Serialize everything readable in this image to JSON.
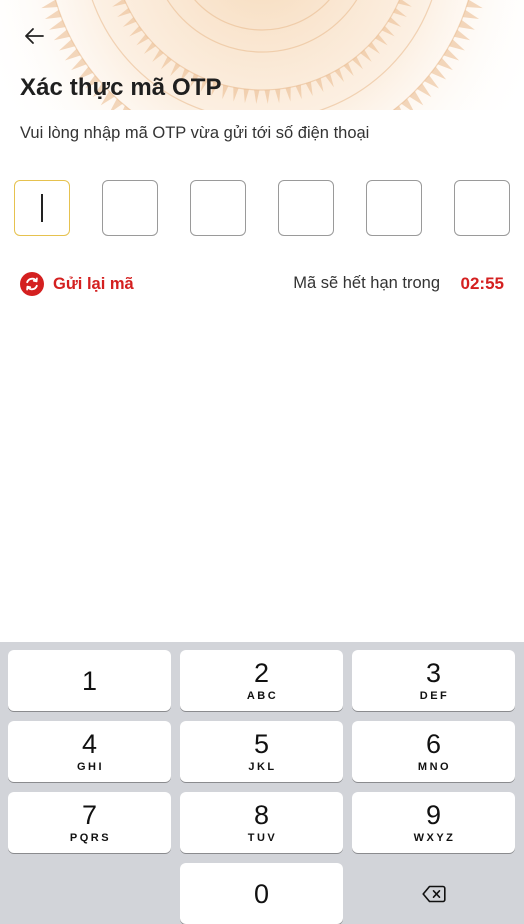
{
  "header": {
    "back_icon": "arrow-left-icon",
    "title": "Xác thực mã OTP",
    "subtitle": "Vui lòng nhập mã OTP vừa gửi tới số điện thoại"
  },
  "otp": {
    "length": 6,
    "values": [
      "",
      "",
      "",
      "",
      "",
      ""
    ],
    "active_index": 0,
    "active_color": "#e6c24f"
  },
  "resend": {
    "icon": "refresh-icon",
    "label": "Gửi lại mã"
  },
  "expiry": {
    "label": "Mã sẽ hết hạn trong",
    "countdown": "02:55"
  },
  "colors": {
    "accent_red": "#d42020",
    "keypad_bg": "#d2d4d9"
  },
  "keypad": {
    "keys": [
      {
        "digit": "1",
        "letters": ""
      },
      {
        "digit": "2",
        "letters": "ABC"
      },
      {
        "digit": "3",
        "letters": "DEF"
      },
      {
        "digit": "4",
        "letters": "GHI"
      },
      {
        "digit": "5",
        "letters": "JKL"
      },
      {
        "digit": "6",
        "letters": "MNO"
      },
      {
        "digit": "7",
        "letters": "PQRS"
      },
      {
        "digit": "8",
        "letters": "TUV"
      },
      {
        "digit": "9",
        "letters": "WXYZ"
      },
      {
        "digit": "0",
        "letters": ""
      }
    ],
    "delete_icon": "backspace-icon"
  }
}
